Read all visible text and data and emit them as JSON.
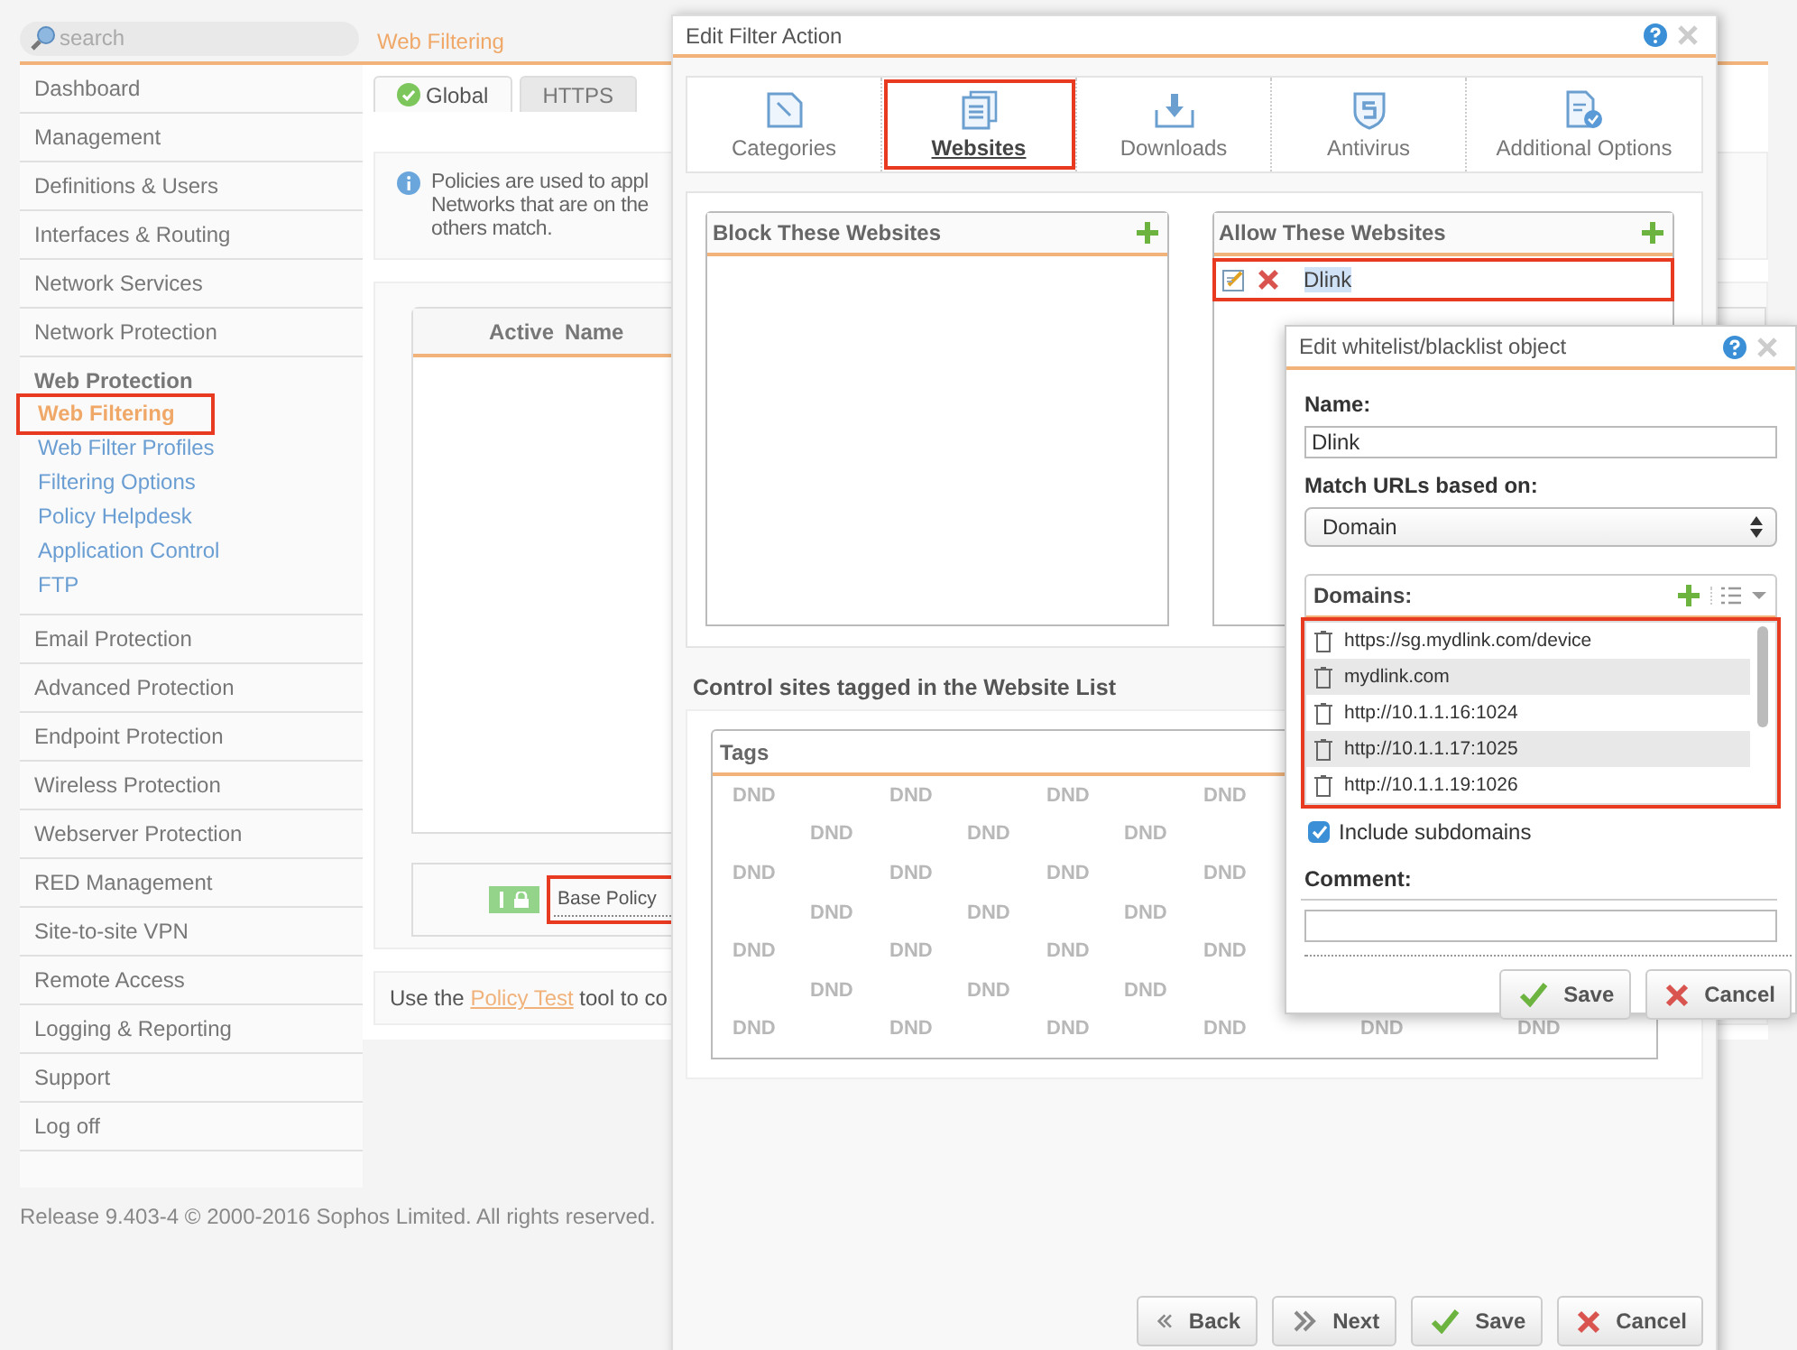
{
  "search": {
    "placeholder": "search"
  },
  "page_title": "Web Filtering",
  "sidebar": {
    "items": [
      {
        "label": "Dashboard",
        "selected": false
      },
      {
        "label": "Management",
        "selected": false
      },
      {
        "label": "Definitions & Users",
        "selected": false
      },
      {
        "label": "Interfaces & Routing",
        "selected": false
      },
      {
        "label": "Network Services",
        "selected": false
      },
      {
        "label": "Network Protection",
        "selected": false
      },
      {
        "label": "Web Protection",
        "selected": true,
        "children": [
          {
            "label": "Web Filtering",
            "selected": true,
            "annotated": true
          },
          {
            "label": "Web Filter Profiles",
            "selected": false,
            "annotated": false
          },
          {
            "label": "Filtering Options",
            "selected": false,
            "annotated": false
          },
          {
            "label": "Policy Helpdesk",
            "selected": false,
            "annotated": false
          },
          {
            "label": "Application Control",
            "selected": false,
            "annotated": false
          },
          {
            "label": "FTP",
            "selected": false,
            "annotated": false
          }
        ]
      },
      {
        "label": "Email Protection",
        "selected": false
      },
      {
        "label": "Advanced Protection",
        "selected": false
      },
      {
        "label": "Endpoint Protection",
        "selected": false
      },
      {
        "label": "Wireless Protection",
        "selected": false
      },
      {
        "label": "Webserver Protection",
        "selected": false
      },
      {
        "label": "RED Management",
        "selected": false
      },
      {
        "label": "Site-to-site VPN",
        "selected": false
      },
      {
        "label": "Remote Access",
        "selected": false
      },
      {
        "label": "Logging & Reporting",
        "selected": false
      },
      {
        "label": "Support",
        "selected": false
      },
      {
        "label": "Log off",
        "selected": false
      }
    ]
  },
  "content_tabs": [
    {
      "label": "Global",
      "selected": true
    },
    {
      "label": "HTTPS",
      "selected": false
    }
  ],
  "info_text": [
    "Policies are used to appl",
    "Networks that are on the",
    "others match."
  ],
  "policy_table": {
    "columns": [
      "Active",
      "Name"
    ],
    "base_row": {
      "on": true,
      "name": "Base Policy",
      "annotated": true
    }
  },
  "policy_test_note": {
    "before": "Use the ",
    "link": "Policy Test",
    "after": " tool to co"
  },
  "footer": "Release 9.403-4  © 2000-2016 Sophos Limited. All rights reserved.",
  "filter_dialog": {
    "title": "Edit Filter Action",
    "tabs": [
      {
        "label": "Categories",
        "kind": "categories",
        "selected": false,
        "annotated": false
      },
      {
        "label": "Websites",
        "kind": "websites",
        "selected": true,
        "annotated": true
      },
      {
        "label": "Downloads",
        "kind": "downloads",
        "selected": false,
        "annotated": false
      },
      {
        "label": "Antivirus",
        "kind": "antivirus",
        "selected": false,
        "annotated": false
      },
      {
        "label": "Additional Options",
        "kind": "options",
        "selected": false,
        "annotated": false
      }
    ],
    "block_list": {
      "title": "Block These Websites"
    },
    "allow_list": {
      "title": "Allow These Websites",
      "items": [
        {
          "name": "Dlink",
          "selected": true,
          "annotated": true
        }
      ]
    },
    "tags_section": {
      "title": "Control sites tagged in the Website List",
      "header": "Tags",
      "pattern_rows": [
        [
          "DND",
          "DND",
          "DND",
          "DND"
        ],
        [
          "DND",
          "DND",
          "DND"
        ],
        [
          "DND",
          "DND",
          "DND",
          "DND"
        ],
        [
          "DND",
          "DND",
          "DND"
        ],
        [
          "DND",
          "DND",
          "DND",
          "DND"
        ],
        [
          "DND",
          "DND",
          "DND"
        ],
        [
          "DND",
          "DND",
          "DND",
          "DND",
          "DND",
          "DND"
        ]
      ]
    },
    "buttons": [
      {
        "label": "Back",
        "kind": "back"
      },
      {
        "label": "Next",
        "kind": "next"
      },
      {
        "label": "Save",
        "kind": "save"
      },
      {
        "label": "Cancel",
        "kind": "cancel"
      }
    ]
  },
  "object_dialog": {
    "title": "Edit whitelist/blacklist object",
    "name_label": "Name:",
    "name_value": "Dlink",
    "match_label": "Match URLs based on:",
    "match_value": "Domain",
    "domains": {
      "title": "Domains:",
      "annotated": true,
      "items": [
        "https://sg.mydlink.com/device",
        "mydlink.com",
        "http://10.1.1.16:1024",
        "http://10.1.1.17:1025",
        "http://10.1.1.19:1026"
      ]
    },
    "include_subdomains": {
      "label": "Include subdomains",
      "checked": true
    },
    "comment_label": "Comment:",
    "buttons": [
      {
        "label": "Save",
        "kind": "save"
      },
      {
        "label": "Cancel",
        "kind": "cancel"
      }
    ]
  }
}
